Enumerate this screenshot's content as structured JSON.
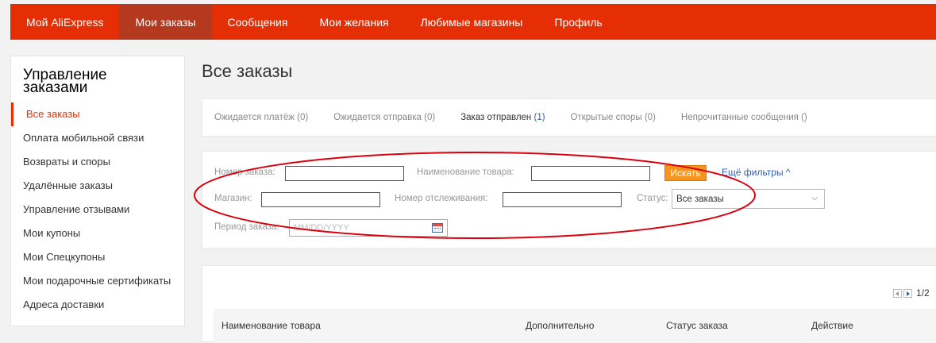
{
  "nav": {
    "items": [
      "Мой AliExpress",
      "Мои заказы",
      "Сообщения",
      "Мои желания",
      "Любимые магазины",
      "Профиль"
    ],
    "active_index": 1
  },
  "sidebar": {
    "title": "Управление заказами",
    "items": [
      "Все заказы",
      "Оплата мобильной связи",
      "Возвраты и споры",
      "Удалённые заказы",
      "Управление отзывами",
      "Мои купоны",
      "Мои Спецкупоны",
      "Мои подарочные сертификаты",
      "Адреса доставки"
    ],
    "active_index": 0
  },
  "page": {
    "title": "Все заказы"
  },
  "tabs": [
    {
      "label": "Ожидается платёж",
      "count": "(0)"
    },
    {
      "label": "Ожидается отправка",
      "count": "(0)"
    },
    {
      "label": "Заказ отправлен",
      "count": "(1)"
    },
    {
      "label": "Открытые споры",
      "count": "(0)"
    },
    {
      "label": "Непрочитанные сообщения",
      "count": "()"
    }
  ],
  "filters": {
    "order_number_label": "Номер заказа:",
    "order_number_value": "",
    "product_name_label": "Наименование товара:",
    "product_name_value": "",
    "search_label": "Искать",
    "more_filters_label": "Ещё фильтры ^",
    "store_label": "Магазин:",
    "store_value": "",
    "tracking_label": "Номер отслеживания:",
    "tracking_value": "",
    "status_label": "Статус:",
    "status_value": "Все заказы",
    "period_label": "Период заказа:",
    "period_placeholder": "MM/DD/YYYY"
  },
  "annotation": {
    "color": "#d9000d"
  },
  "results": {
    "pagination": "1/2",
    "columns": [
      "Наименование товара",
      "Дополнительно",
      "Статус заказа",
      "Действие"
    ]
  },
  "colors": {
    "brand": "#e62e04",
    "active_nav": "#b5391f",
    "search_button": "#f7941d",
    "link": "#2e5fb3"
  }
}
